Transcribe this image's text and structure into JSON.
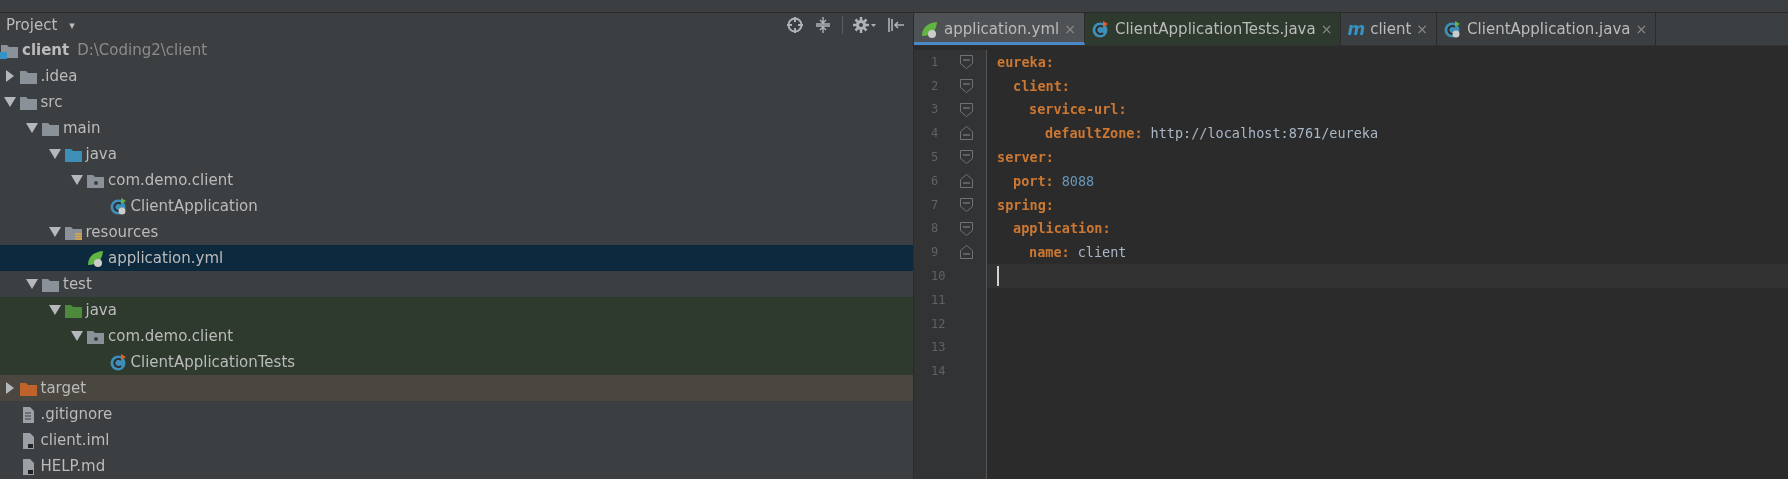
{
  "project_panel": {
    "title": "Project",
    "title_caret": "▾",
    "tree": [
      {
        "label": "client",
        "hint": "D:\\Coding2\\client",
        "kind": "module",
        "children": [
          {
            "label": ".idea",
            "kind": "folder",
            "expanded": false
          },
          {
            "label": "src",
            "kind": "folder",
            "expanded": true,
            "children": [
              {
                "label": "main",
                "kind": "folder",
                "expanded": true,
                "children": [
                  {
                    "label": "java",
                    "kind": "source-folder",
                    "expanded": true,
                    "children": [
                      {
                        "label": "com.demo.client",
                        "kind": "package",
                        "expanded": true,
                        "children": [
                          {
                            "label": "ClientApplication",
                            "kind": "spring-class"
                          }
                        ]
                      }
                    ]
                  },
                  {
                    "label": "resources",
                    "kind": "resources-folder",
                    "expanded": true,
                    "children": [
                      {
                        "label": "application.yml",
                        "kind": "spring-yml",
                        "selected": true
                      }
                    ]
                  }
                ]
              },
              {
                "label": "test",
                "kind": "folder",
                "expanded": true,
                "children": [
                  {
                    "label": "java",
                    "kind": "test-folder",
                    "expanded": true,
                    "children": [
                      {
                        "label": "com.demo.client",
                        "kind": "test-package",
                        "expanded": true,
                        "children": [
                          {
                            "label": "ClientApplicationTests",
                            "kind": "test-class"
                          }
                        ]
                      }
                    ]
                  }
                ]
              }
            ]
          },
          {
            "label": "target",
            "kind": "excluded-folder",
            "expanded": false
          },
          {
            "label": ".gitignore",
            "kind": "text-file"
          },
          {
            "label": "client.iml",
            "kind": "module-file"
          },
          {
            "label": "HELP.md",
            "kind": "markdown-file"
          }
        ]
      }
    ]
  },
  "editor": {
    "tabs": [
      {
        "label": "application.yml",
        "kind": "spring-yml",
        "close": "×",
        "selected": true
      },
      {
        "label": "ClientApplicationTests.java",
        "kind": "test-class",
        "close": "×",
        "selected": false
      },
      {
        "label": "client",
        "kind": "maven",
        "icon_text": "m",
        "close": "×",
        "selected": false
      },
      {
        "label": "ClientApplication.java",
        "kind": "spring-class",
        "close": "×",
        "selected": false
      }
    ],
    "yaml": [
      {
        "number": "1",
        "key": "eureka:",
        "current": false,
        "children": [
          {
            "number": "2",
            "key": "client:",
            "current": false,
            "children": [
              {
                "number": "3",
                "key": "service-url:",
                "current": false,
                "children": [
                  {
                    "number": "4",
                    "key": "defaultZone:",
                    "value": "http://localhost:8761/eureka",
                    "kind": "string",
                    "current": false
                  }
                ]
              }
            ]
          }
        ]
      },
      {
        "number": "5",
        "key": "server:",
        "current": false,
        "children": [
          {
            "number": "6",
            "key": "port:",
            "value": "8088",
            "kind": "number",
            "current": false
          }
        ]
      },
      {
        "number": "7",
        "key": "spring:",
        "current": false,
        "children": [
          {
            "number": "8",
            "key": "application:",
            "current": false,
            "children": [
              {
                "number": "9",
                "key": "name:",
                "value": "client",
                "kind": "string",
                "current": false
              }
            ]
          }
        ]
      }
    ],
    "blank_lines": [
      {
        "number": "10",
        "current": true
      },
      {
        "number": "11",
        "current": false
      },
      {
        "number": "12",
        "current": false
      },
      {
        "number": "13",
        "current": false
      },
      {
        "number": "14",
        "current": false
      }
    ]
  }
}
